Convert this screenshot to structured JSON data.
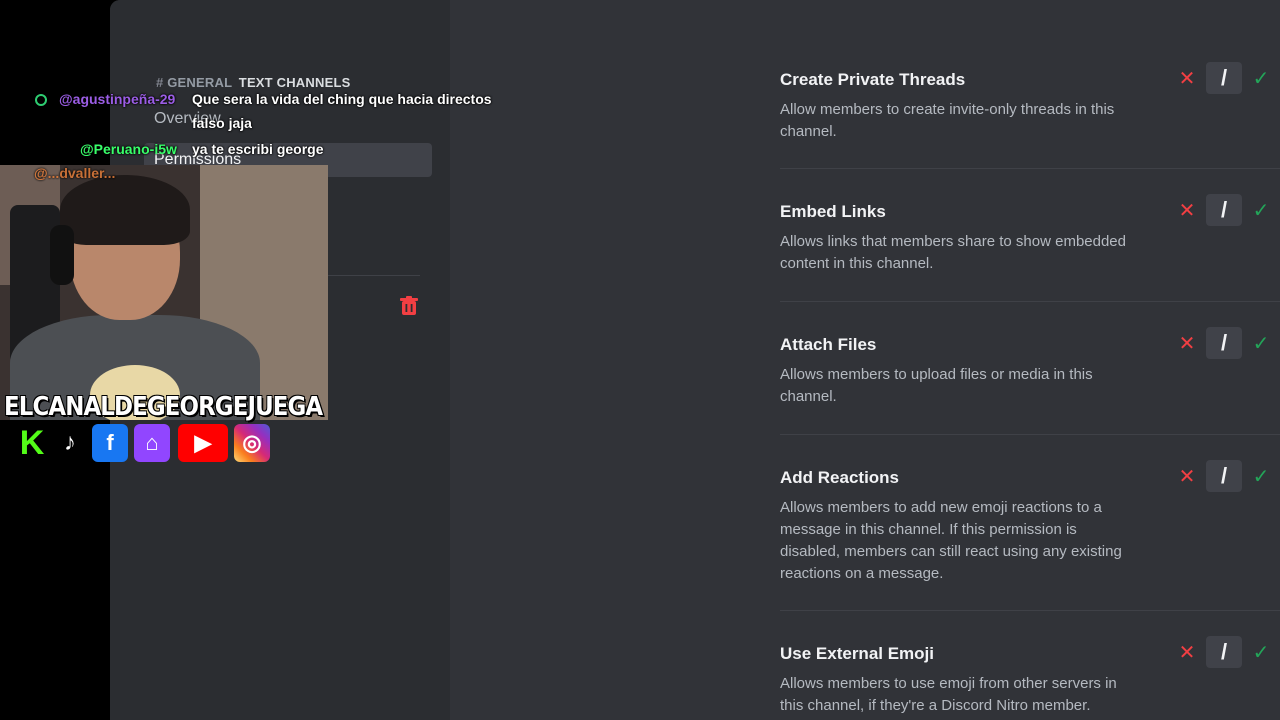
{
  "sidebar": {
    "category_hash": "#",
    "category_name": "GENERAL",
    "category_sub": "TEXT CHANNELS",
    "nav": {
      "overview": "Overview",
      "permissions": "Permissions"
    },
    "delete_icon": "trash-icon"
  },
  "permissions": [
    {
      "title": "Create Private Threads",
      "description": "Allow members to create invite-only threads in this channel."
    },
    {
      "title": "Embed Links",
      "description": "Allows links that members share to show embedded content in this channel."
    },
    {
      "title": "Attach Files",
      "description": "Allows members to upload files or media in this channel."
    },
    {
      "title": "Add Reactions",
      "description": "Allows members to add new emoji reactions to a message in this channel. If this permission is disabled, members can still react using any existing reactions on a message."
    },
    {
      "title": "Use External Emoji",
      "description": "Allows members to use emoji from other servers in this channel, if they're a Discord Nitro member."
    }
  ],
  "toggle": {
    "deny": "✕",
    "neutral": "/",
    "allow": "✓"
  },
  "overlay": {
    "chat": [
      {
        "user": "@agustinpeña-29",
        "text": "Que sera la vida del ching que hacia directos",
        "text2": "falso jaja"
      },
      {
        "user": "@Peruano-i5w",
        "text": "ya te escribi george"
      },
      {
        "user": "@...dvaller..."
      }
    ],
    "channel_name": "ELCANALDEGEORGEJUEGA",
    "socials": [
      "kick-icon",
      "tiktok-icon",
      "facebook-icon",
      "twitch-icon",
      "youtube-icon",
      "instagram-icon"
    ],
    "social_glyphs": {
      "kick": "K",
      "tiktok": "♪",
      "facebook": "f",
      "twitch": "⌂",
      "youtube": "▶",
      "instagram": "◎"
    }
  },
  "colors": {
    "deny": "#f23f43",
    "allow": "#23a559",
    "background": "#313338",
    "sidebar": "#2b2d31"
  }
}
